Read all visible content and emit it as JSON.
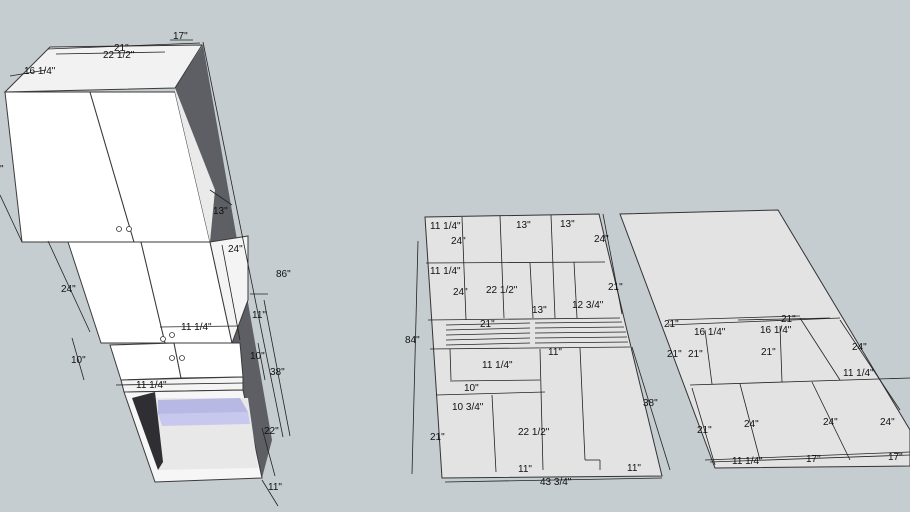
{
  "colors": {
    "background": "#c5cdd0",
    "panel_white": "#ffffff",
    "panel_light": "#f4f4f4",
    "panel_dark": "#5d5f64",
    "sheet_grey": "#e3e3e3",
    "shelf_purple": "#c8c8ee"
  },
  "cabinet": {
    "dims": {
      "top_width_outer": "21\"",
      "top_width_inner": "22 1/2\"",
      "top_depth": "17\"",
      "top_side": "16 1/4\"",
      "height_total": "86\"",
      "side_upper": "13\"",
      "left_upper": "\"",
      "middle_height": "24\"",
      "side_middle": "24\"",
      "middle_shelf": "11 1/4\"",
      "small_side": "11\"",
      "drawer_height": "10\"",
      "drawer_side": "10\"",
      "lower_height": "38\"",
      "drawer_width": "11 1/4\"",
      "base_depth": "22\"",
      "base_bottom": "11\""
    }
  },
  "sheet_a": {
    "dims": {
      "height": "84\"",
      "width_bottom": "43 3/4\"",
      "r1_a": "11 1/4\"",
      "r1_b": "24\"",
      "r1_c": "13\"",
      "r1_d": "13\"",
      "r1_e": "24\"",
      "r2_a": "11 1/4\"",
      "r2_b": "24\"",
      "r2_c": "22 1/2\"",
      "r2_d": "21\"",
      "r2_e": "13\"",
      "r2_f": "12 3/4\"",
      "strip_21": "21\"",
      "strip_11": "11\"",
      "mid_11_1_4": "11 1/4\"",
      "mid_10": "10\"",
      "right_38": "38\"",
      "low_10_3_4": "10 3/4\"",
      "low_21": "21\"",
      "low_22_1_2": "22 1/2\"",
      "low_11_a": "11\"",
      "low_11_b": "11\""
    }
  },
  "sheet_b": {
    "dims": {
      "top_21_a": "21\"",
      "top_21_b": "21\"",
      "top_16_a": "16 1/4\"",
      "top_16_b": "16 1/4\"",
      "left_21_a": "21\"",
      "left_21_b": "21\"",
      "mid_21": "21\"",
      "right_24": "24\"",
      "right_11": "11 1/4\"",
      "left_21_c": "21\"",
      "low_24_a": "24\"",
      "low_24_b": "24\"",
      "low_24_c": "24\"",
      "bot_11": "11 1/4\"",
      "bot_17_a": "17\"",
      "bot_17_b": "17\""
    }
  }
}
